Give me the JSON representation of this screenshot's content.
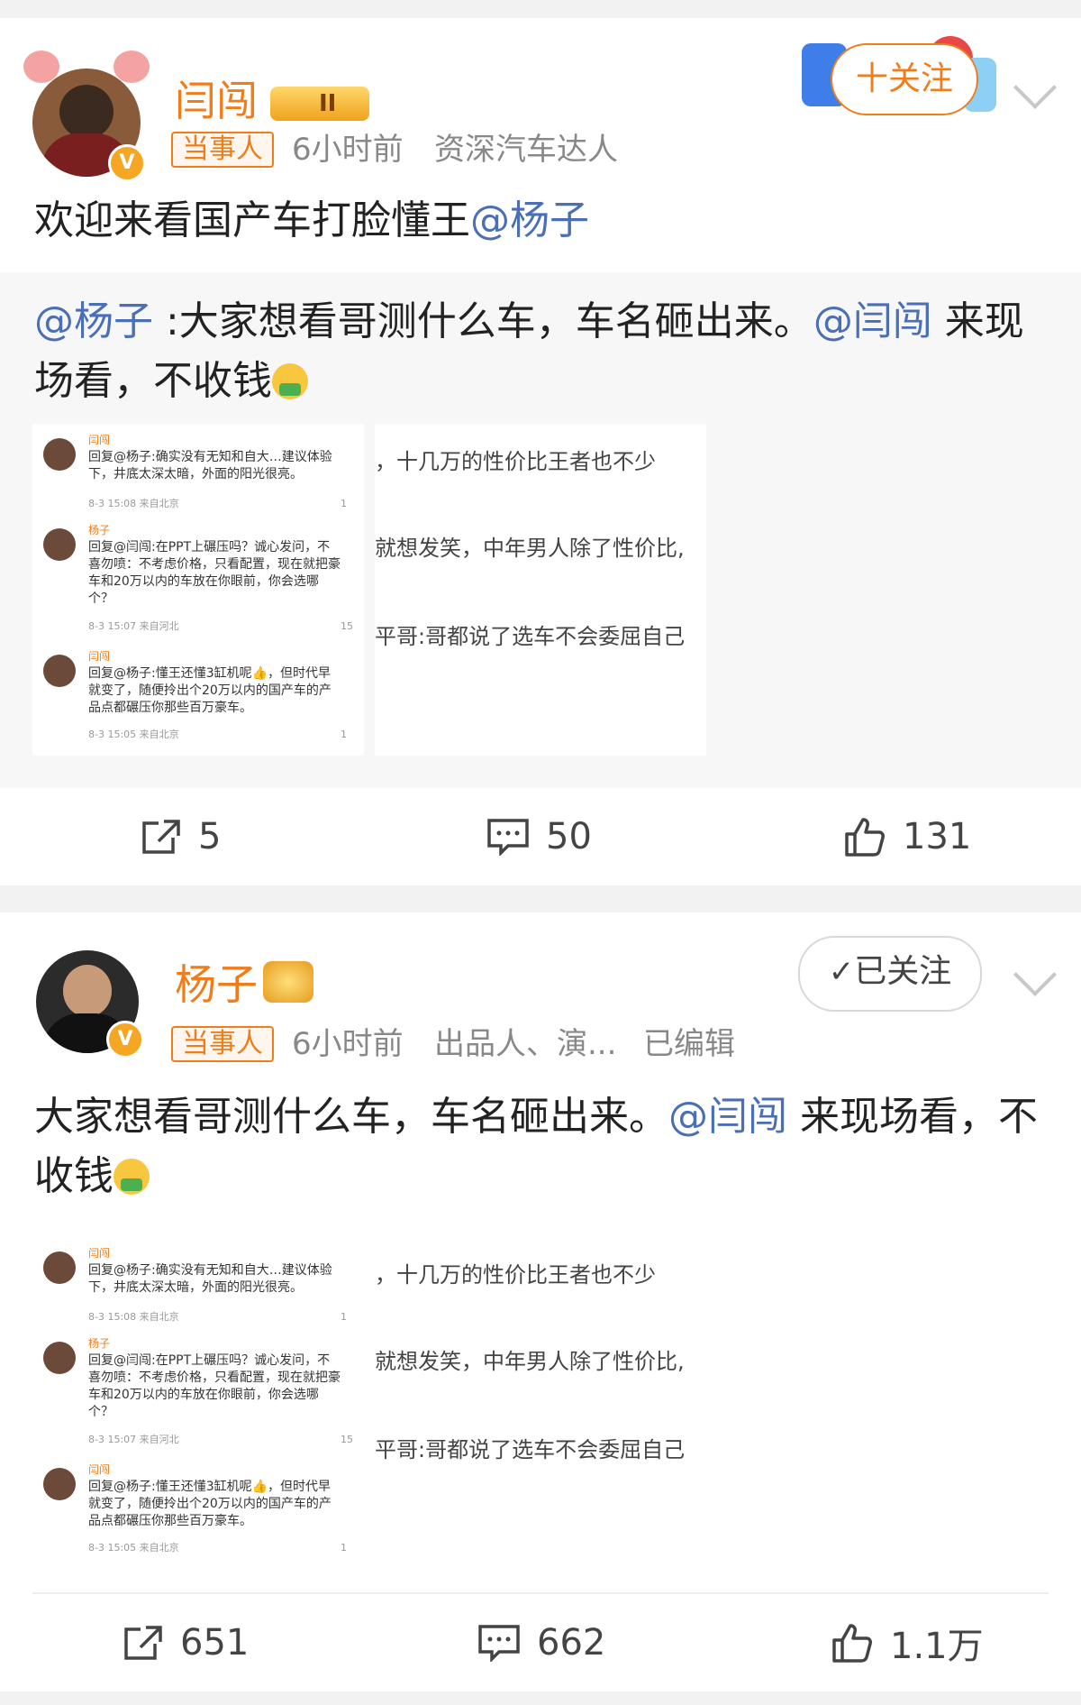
{
  "posts": [
    {
      "username": "闫闯",
      "level_badge": "II",
      "tag": "当事人",
      "time": "6小时前",
      "bio": "资深汽车达人",
      "follow_label": "十关注",
      "body": "欢迎来看国产车打脸懂王",
      "body_mention": "@杨子",
      "repost": {
        "mention1": "@杨子",
        "text1": " :大家想看哥测什么车，车名砸出来。",
        "mention2": "@闫闯",
        "text2": " 来现场看，不收钱"
      },
      "actions": {
        "share": "5",
        "comment": "50",
        "like": "131"
      }
    },
    {
      "username": "杨子",
      "tag": "当事人",
      "time": "6小时前",
      "bio": "出品人、演...",
      "edited": "已编辑",
      "follow_label": "已关注",
      "body1": "大家想看哥测什么车，车名砸出来。",
      "body_mention": "@闫闯",
      "body2": " 来现场看，不收钱",
      "actions": {
        "share": "651",
        "comment": "662",
        "like": "1.1万"
      }
    }
  ],
  "screenshot": {
    "comments": [
      {
        "name": "闫闯",
        "text": "回复@杨子:确实没有无知和自大…建议体验下，井底太深太暗，外面的阳光很亮。",
        "meta": "8-3 15:08 来自北京",
        "likes": "1"
      },
      {
        "name": "杨子",
        "text": "回复@闫闯:在PPT上碾压吗？诚心发问，不喜勿喷：不考虑价格，只看配置，现在就把豪车和20万以内的车放在你眼前，你会选哪个？",
        "meta": "8-3 15:07 来自河北",
        "likes": "15"
      },
      {
        "name": "闫闯",
        "text": "回复@杨子:懂王还懂3缸机呢👍，但时代早就变了，随便拎出个20万以内的国产车的产品点都碾压你那些百万豪车。",
        "meta": "8-3 15:05 来自北京",
        "likes": "1"
      }
    ],
    "strip_lines": [
      "，十几万的性价比王者也不少",
      "就想发笑，中年男人除了性价比,",
      "平哥:哥都说了选车不会委屈自己"
    ]
  }
}
